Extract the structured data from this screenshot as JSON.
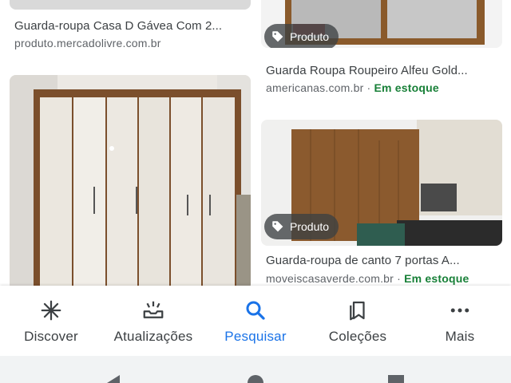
{
  "results": [
    {
      "title": "Guarda-roupa Casa D Gávea Com 2...",
      "source": "produto.mercadolivre.com.br",
      "stock": ""
    },
    {
      "title": "Guarda Roupa Roupeiro Alfeu Gold...",
      "source": "americanas.com.br",
      "separator": "·",
      "stock": "Em estoque",
      "badge": "Produto"
    },
    {
      "title": "",
      "source": "",
      "stock": ""
    },
    {
      "title": "Guarda-roupa de canto 7 portas A...",
      "source": "moveiscasaverde.com.br",
      "separator": "·",
      "stock": "Em estoque",
      "badge": "Produto"
    }
  ],
  "bottom_nav": {
    "items": [
      {
        "label": "Discover",
        "icon": "asterisk-icon",
        "active": false
      },
      {
        "label": "Atualizações",
        "icon": "inbox-updates-icon",
        "active": false
      },
      {
        "label": "Pesquisar",
        "icon": "search-icon",
        "active": true
      },
      {
        "label": "Coleções",
        "icon": "bookmarks-icon",
        "active": false
      },
      {
        "label": "Mais",
        "icon": "more-horizontal-icon",
        "active": false
      }
    ]
  },
  "system_nav": {
    "icons": [
      "back-icon",
      "home-icon",
      "recents-icon"
    ]
  },
  "colors": {
    "accent": "#1a73e8",
    "stock": "#188038",
    "text": "#3c4043",
    "muted": "#5f6368"
  }
}
